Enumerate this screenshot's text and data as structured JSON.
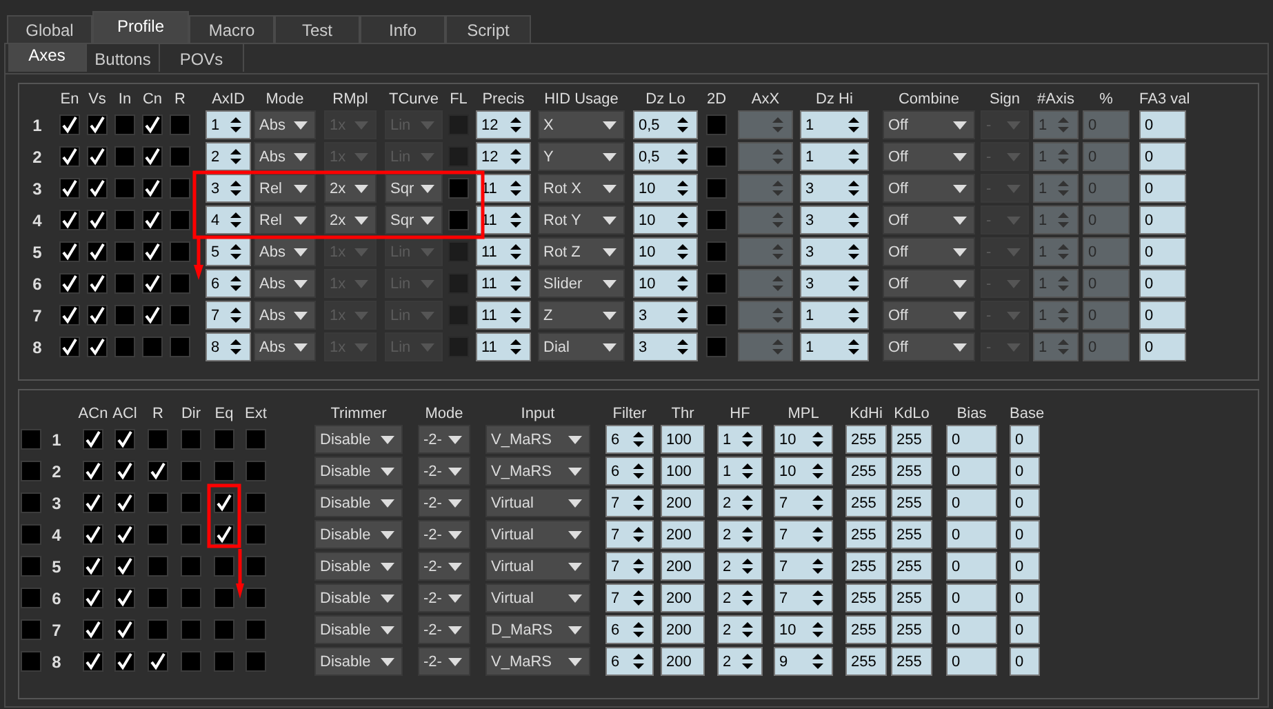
{
  "tabs": [
    {
      "label": "Global",
      "selected": false
    },
    {
      "label": "Profile",
      "selected": true
    },
    {
      "label": "Macro",
      "selected": false
    },
    {
      "label": "Test",
      "selected": false
    },
    {
      "label": "Info",
      "selected": false
    },
    {
      "label": "Script",
      "selected": false
    }
  ],
  "subtabs": [
    {
      "label": "Axes",
      "selected": true
    },
    {
      "label": "Buttons",
      "selected": false
    },
    {
      "label": "POVs",
      "selected": false
    }
  ],
  "axes": {
    "columns": [
      {
        "label": "En",
        "kind": "check"
      },
      {
        "label": "Vs",
        "kind": "check"
      },
      {
        "label": "In",
        "kind": "check"
      },
      {
        "label": "Cn",
        "kind": "check"
      },
      {
        "label": "R",
        "kind": "check"
      },
      {
        "label": "AxID",
        "kind": "spinner"
      },
      {
        "label": "Mode",
        "kind": "dropdown"
      },
      {
        "label": "RMpl",
        "kind": "dropdown"
      },
      {
        "label": "TCurve",
        "kind": "dropdown"
      },
      {
        "label": "FL",
        "kind": "check"
      },
      {
        "label": "Precis",
        "kind": "spinner"
      },
      {
        "label": "HID Usage",
        "kind": "dropdown"
      },
      {
        "label": "Dz Lo",
        "kind": "spinner"
      },
      {
        "label": "2D",
        "kind": "check"
      },
      {
        "label": "AxX",
        "kind": "spinner"
      },
      {
        "label": "Dz Hi",
        "kind": "spinner"
      },
      {
        "label": "Combine",
        "kind": "dropdown"
      },
      {
        "label": "Sign",
        "kind": "dropdown"
      },
      {
        "label": "#Axis",
        "kind": "spinner"
      },
      {
        "label": "%",
        "kind": "field"
      },
      {
        "label": "FA3 val",
        "kind": "field"
      }
    ],
    "rows": [
      {
        "number": "1",
        "cells": [
          {
            "checked": true,
            "disabled": false
          },
          {
            "checked": true,
            "disabled": false
          },
          {
            "checked": false,
            "disabled": false
          },
          {
            "checked": true,
            "disabled": false
          },
          {
            "checked": false,
            "disabled": false
          },
          {
            "value": "1",
            "disabled": false
          },
          {
            "value": "Abs",
            "disabled": false
          },
          {
            "value": "1x",
            "disabled": true
          },
          {
            "value": "Lin",
            "disabled": true
          },
          {
            "checked": false,
            "disabled": true
          },
          {
            "value": "12",
            "disabled": false
          },
          {
            "value": "X",
            "disabled": false
          },
          {
            "value": "0,5",
            "disabled": false
          },
          {
            "checked": false,
            "disabled": false
          },
          {
            "disabled": true
          },
          {
            "value": "1",
            "disabled": false
          },
          {
            "value": "Off",
            "disabled": false
          },
          {
            "value": "-",
            "disabled": true
          },
          {
            "value": "1",
            "disabled": true
          },
          {
            "value": "0",
            "disabled": true
          },
          {
            "value": "0",
            "disabled": false
          }
        ]
      },
      {
        "number": "2",
        "cells": [
          {
            "checked": true,
            "disabled": false
          },
          {
            "checked": true,
            "disabled": false
          },
          {
            "checked": false,
            "disabled": false
          },
          {
            "checked": true,
            "disabled": false
          },
          {
            "checked": false,
            "disabled": false
          },
          {
            "value": "2",
            "disabled": false
          },
          {
            "value": "Abs",
            "disabled": false
          },
          {
            "value": "1x",
            "disabled": true
          },
          {
            "value": "Lin",
            "disabled": true
          },
          {
            "checked": false,
            "disabled": true
          },
          {
            "value": "12",
            "disabled": false
          },
          {
            "value": "Y",
            "disabled": false
          },
          {
            "value": "0,5",
            "disabled": false
          },
          {
            "checked": false,
            "disabled": false
          },
          {
            "disabled": true
          },
          {
            "value": "1",
            "disabled": false
          },
          {
            "value": "Off",
            "disabled": false
          },
          {
            "value": "-",
            "disabled": true
          },
          {
            "value": "1",
            "disabled": true
          },
          {
            "value": "0",
            "disabled": true
          },
          {
            "value": "0",
            "disabled": false
          }
        ]
      },
      {
        "number": "3",
        "cells": [
          {
            "checked": true,
            "disabled": false
          },
          {
            "checked": true,
            "disabled": false
          },
          {
            "checked": false,
            "disabled": false
          },
          {
            "checked": true,
            "disabled": false
          },
          {
            "checked": false,
            "disabled": false
          },
          {
            "value": "3",
            "disabled": false
          },
          {
            "value": "Rel",
            "disabled": false
          },
          {
            "value": "2x",
            "disabled": false
          },
          {
            "value": "Sqr",
            "disabled": false
          },
          {
            "checked": false,
            "disabled": false
          },
          {
            "value": "11",
            "disabled": false
          },
          {
            "value": "Rot X",
            "disabled": false
          },
          {
            "value": "10",
            "disabled": false
          },
          {
            "checked": false,
            "disabled": false
          },
          {
            "disabled": true
          },
          {
            "value": "3",
            "disabled": false
          },
          {
            "value": "Off",
            "disabled": false
          },
          {
            "value": "-",
            "disabled": true
          },
          {
            "value": "1",
            "disabled": true
          },
          {
            "value": "0",
            "disabled": true
          },
          {
            "value": "0",
            "disabled": false
          }
        ]
      },
      {
        "number": "4",
        "cells": [
          {
            "checked": true,
            "disabled": false
          },
          {
            "checked": true,
            "disabled": false
          },
          {
            "checked": false,
            "disabled": false
          },
          {
            "checked": true,
            "disabled": false
          },
          {
            "checked": false,
            "disabled": false
          },
          {
            "value": "4",
            "disabled": false
          },
          {
            "value": "Rel",
            "disabled": false
          },
          {
            "value": "2x",
            "disabled": false
          },
          {
            "value": "Sqr",
            "disabled": false
          },
          {
            "checked": false,
            "disabled": false
          },
          {
            "value": "11",
            "disabled": false
          },
          {
            "value": "Rot Y",
            "disabled": false
          },
          {
            "value": "10",
            "disabled": false
          },
          {
            "checked": false,
            "disabled": false
          },
          {
            "disabled": true
          },
          {
            "value": "3",
            "disabled": false
          },
          {
            "value": "Off",
            "disabled": false
          },
          {
            "value": "-",
            "disabled": true
          },
          {
            "value": "1",
            "disabled": true
          },
          {
            "value": "0",
            "disabled": true
          },
          {
            "value": "0",
            "disabled": false
          }
        ]
      },
      {
        "number": "5",
        "cells": [
          {
            "checked": true,
            "disabled": false
          },
          {
            "checked": true,
            "disabled": false
          },
          {
            "checked": false,
            "disabled": false
          },
          {
            "checked": true,
            "disabled": false
          },
          {
            "checked": false,
            "disabled": false
          },
          {
            "value": "5",
            "disabled": false
          },
          {
            "value": "Abs",
            "disabled": false
          },
          {
            "value": "1x",
            "disabled": true
          },
          {
            "value": "Lin",
            "disabled": true
          },
          {
            "checked": false,
            "disabled": true
          },
          {
            "value": "11",
            "disabled": false
          },
          {
            "value": "Rot Z",
            "disabled": false
          },
          {
            "value": "10",
            "disabled": false
          },
          {
            "checked": false,
            "disabled": false
          },
          {
            "disabled": true
          },
          {
            "value": "3",
            "disabled": false
          },
          {
            "value": "Off",
            "disabled": false
          },
          {
            "value": "-",
            "disabled": true
          },
          {
            "value": "1",
            "disabled": true
          },
          {
            "value": "0",
            "disabled": true
          },
          {
            "value": "0",
            "disabled": false
          }
        ]
      },
      {
        "number": "6",
        "cells": [
          {
            "checked": true,
            "disabled": false
          },
          {
            "checked": true,
            "disabled": false
          },
          {
            "checked": false,
            "disabled": false
          },
          {
            "checked": true,
            "disabled": false
          },
          {
            "checked": false,
            "disabled": false
          },
          {
            "value": "6",
            "disabled": false
          },
          {
            "value": "Abs",
            "disabled": false
          },
          {
            "value": "1x",
            "disabled": true
          },
          {
            "value": "Lin",
            "disabled": true
          },
          {
            "checked": false,
            "disabled": true
          },
          {
            "value": "11",
            "disabled": false
          },
          {
            "value": "Slider",
            "disabled": false
          },
          {
            "value": "10",
            "disabled": false
          },
          {
            "checked": false,
            "disabled": false
          },
          {
            "disabled": true
          },
          {
            "value": "3",
            "disabled": false
          },
          {
            "value": "Off",
            "disabled": false
          },
          {
            "value": "-",
            "disabled": true
          },
          {
            "value": "1",
            "disabled": true
          },
          {
            "value": "0",
            "disabled": true
          },
          {
            "value": "0",
            "disabled": false
          }
        ]
      },
      {
        "number": "7",
        "cells": [
          {
            "checked": true,
            "disabled": false
          },
          {
            "checked": true,
            "disabled": false
          },
          {
            "checked": false,
            "disabled": false
          },
          {
            "checked": true,
            "disabled": false
          },
          {
            "checked": false,
            "disabled": false
          },
          {
            "value": "7",
            "disabled": false
          },
          {
            "value": "Abs",
            "disabled": false
          },
          {
            "value": "1x",
            "disabled": true
          },
          {
            "value": "Lin",
            "disabled": true
          },
          {
            "checked": false,
            "disabled": true
          },
          {
            "value": "11",
            "disabled": false
          },
          {
            "value": "Z",
            "disabled": false
          },
          {
            "value": "3",
            "disabled": false
          },
          {
            "checked": false,
            "disabled": false
          },
          {
            "disabled": true
          },
          {
            "value": "1",
            "disabled": false
          },
          {
            "value": "Off",
            "disabled": false
          },
          {
            "value": "-",
            "disabled": true
          },
          {
            "value": "1",
            "disabled": true
          },
          {
            "value": "0",
            "disabled": true
          },
          {
            "value": "0",
            "disabled": false
          }
        ]
      },
      {
        "number": "8",
        "cells": [
          {
            "checked": true,
            "disabled": false
          },
          {
            "checked": true,
            "disabled": false
          },
          {
            "checked": false,
            "disabled": false
          },
          {
            "checked": false,
            "disabled": false
          },
          {
            "checked": false,
            "disabled": false
          },
          {
            "value": "8",
            "disabled": false
          },
          {
            "value": "Abs",
            "disabled": false
          },
          {
            "value": "1x",
            "disabled": true
          },
          {
            "value": "Lin",
            "disabled": true
          },
          {
            "checked": false,
            "disabled": true
          },
          {
            "value": "11",
            "disabled": false
          },
          {
            "value": "Dial",
            "disabled": false
          },
          {
            "value": "3",
            "disabled": false
          },
          {
            "checked": false,
            "disabled": false
          },
          {
            "disabled": true
          },
          {
            "value": "1",
            "disabled": false
          },
          {
            "value": "Off",
            "disabled": false
          },
          {
            "value": "-",
            "disabled": true
          },
          {
            "value": "1",
            "disabled": true
          },
          {
            "value": "0",
            "disabled": true
          },
          {
            "value": "0",
            "disabled": false
          }
        ]
      }
    ]
  },
  "filters": {
    "columns": [
      {
        "label": "ACn",
        "kind": "check"
      },
      {
        "label": "ACl",
        "kind": "check"
      },
      {
        "label": "R",
        "kind": "check"
      },
      {
        "label": "Dir",
        "kind": "check"
      },
      {
        "label": "Eq",
        "kind": "check"
      },
      {
        "label": "Ext",
        "kind": "check"
      },
      {
        "label": "Trimmer",
        "kind": "dropdown"
      },
      {
        "label": "Mode",
        "kind": "dropdown"
      },
      {
        "label": "Input",
        "kind": "dropdown"
      },
      {
        "label": "Filter",
        "kind": "spinner"
      },
      {
        "label": "Thr",
        "kind": "field"
      },
      {
        "label": "HF",
        "kind": "spinner"
      },
      {
        "label": "MPL",
        "kind": "spinner"
      },
      {
        "label": "KdHi",
        "kind": "field"
      },
      {
        "label": "KdLo",
        "kind": "field"
      },
      {
        "label": "Bias",
        "kind": "field"
      },
      {
        "label": "Base",
        "kind": "field"
      }
    ],
    "rows": [
      {
        "checked": false,
        "number": "1",
        "cells": [
          {
            "checked": true
          },
          {
            "checked": true
          },
          {
            "checked": false
          },
          {
            "checked": false
          },
          {
            "checked": false
          },
          {
            "checked": false
          },
          {
            "value": "Disable"
          },
          {
            "value": "-2-"
          },
          {
            "value": "V_MaRS"
          },
          {
            "value": "6"
          },
          {
            "value": "100"
          },
          {
            "value": "1"
          },
          {
            "value": "10"
          },
          {
            "value": "255"
          },
          {
            "value": "255"
          },
          {
            "value": "0"
          },
          {
            "value": "0"
          }
        ]
      },
      {
        "checked": false,
        "number": "2",
        "cells": [
          {
            "checked": true
          },
          {
            "checked": true
          },
          {
            "checked": true
          },
          {
            "checked": false
          },
          {
            "checked": false
          },
          {
            "checked": false
          },
          {
            "value": "Disable"
          },
          {
            "value": "-2-"
          },
          {
            "value": "V_MaRS"
          },
          {
            "value": "6"
          },
          {
            "value": "100"
          },
          {
            "value": "1"
          },
          {
            "value": "10"
          },
          {
            "value": "255"
          },
          {
            "value": "255"
          },
          {
            "value": "0"
          },
          {
            "value": "0"
          }
        ]
      },
      {
        "checked": false,
        "number": "3",
        "cells": [
          {
            "checked": true
          },
          {
            "checked": true
          },
          {
            "checked": false
          },
          {
            "checked": false
          },
          {
            "checked": true
          },
          {
            "checked": false
          },
          {
            "value": "Disable"
          },
          {
            "value": "-2-"
          },
          {
            "value": "Virtual"
          },
          {
            "value": "7"
          },
          {
            "value": "200"
          },
          {
            "value": "2"
          },
          {
            "value": "7"
          },
          {
            "value": "255"
          },
          {
            "value": "255"
          },
          {
            "value": "0"
          },
          {
            "value": "0"
          }
        ]
      },
      {
        "checked": false,
        "number": "4",
        "cells": [
          {
            "checked": true
          },
          {
            "checked": true
          },
          {
            "checked": false
          },
          {
            "checked": false
          },
          {
            "checked": true
          },
          {
            "checked": false
          },
          {
            "value": "Disable"
          },
          {
            "value": "-2-"
          },
          {
            "value": "Virtual"
          },
          {
            "value": "7"
          },
          {
            "value": "200"
          },
          {
            "value": "2"
          },
          {
            "value": "7"
          },
          {
            "value": "255"
          },
          {
            "value": "255"
          },
          {
            "value": "0"
          },
          {
            "value": "0"
          }
        ]
      },
      {
        "checked": false,
        "number": "5",
        "cells": [
          {
            "checked": true
          },
          {
            "checked": true
          },
          {
            "checked": false
          },
          {
            "checked": false
          },
          {
            "checked": false
          },
          {
            "checked": false
          },
          {
            "value": "Disable"
          },
          {
            "value": "-2-"
          },
          {
            "value": "Virtual"
          },
          {
            "value": "7"
          },
          {
            "value": "200"
          },
          {
            "value": "2"
          },
          {
            "value": "7"
          },
          {
            "value": "255"
          },
          {
            "value": "255"
          },
          {
            "value": "0"
          },
          {
            "value": "0"
          }
        ]
      },
      {
        "checked": false,
        "number": "6",
        "cells": [
          {
            "checked": true
          },
          {
            "checked": true
          },
          {
            "checked": false
          },
          {
            "checked": false
          },
          {
            "checked": false
          },
          {
            "checked": false
          },
          {
            "value": "Disable"
          },
          {
            "value": "-2-"
          },
          {
            "value": "Virtual"
          },
          {
            "value": "7"
          },
          {
            "value": "200"
          },
          {
            "value": "2"
          },
          {
            "value": "7"
          },
          {
            "value": "255"
          },
          {
            "value": "255"
          },
          {
            "value": "0"
          },
          {
            "value": "0"
          }
        ]
      },
      {
        "checked": false,
        "number": "7",
        "cells": [
          {
            "checked": true
          },
          {
            "checked": true
          },
          {
            "checked": false
          },
          {
            "checked": false
          },
          {
            "checked": false
          },
          {
            "checked": false
          },
          {
            "value": "Disable"
          },
          {
            "value": "-2-"
          },
          {
            "value": "D_MaRS"
          },
          {
            "value": "6"
          },
          {
            "value": "200"
          },
          {
            "value": "2"
          },
          {
            "value": "10"
          },
          {
            "value": "255"
          },
          {
            "value": "255"
          },
          {
            "value": "0"
          },
          {
            "value": "0"
          }
        ]
      },
      {
        "checked": false,
        "number": "8",
        "cells": [
          {
            "checked": true
          },
          {
            "checked": true
          },
          {
            "checked": true
          },
          {
            "checked": false
          },
          {
            "checked": false
          },
          {
            "checked": false
          },
          {
            "value": "Disable"
          },
          {
            "value": "-2-"
          },
          {
            "value": "V_MaRS"
          },
          {
            "value": "6"
          },
          {
            "value": "200"
          },
          {
            "value": "2"
          },
          {
            "value": "9"
          },
          {
            "value": "255"
          },
          {
            "value": "255"
          },
          {
            "value": "0"
          },
          {
            "value": "0"
          }
        ]
      }
    ]
  }
}
